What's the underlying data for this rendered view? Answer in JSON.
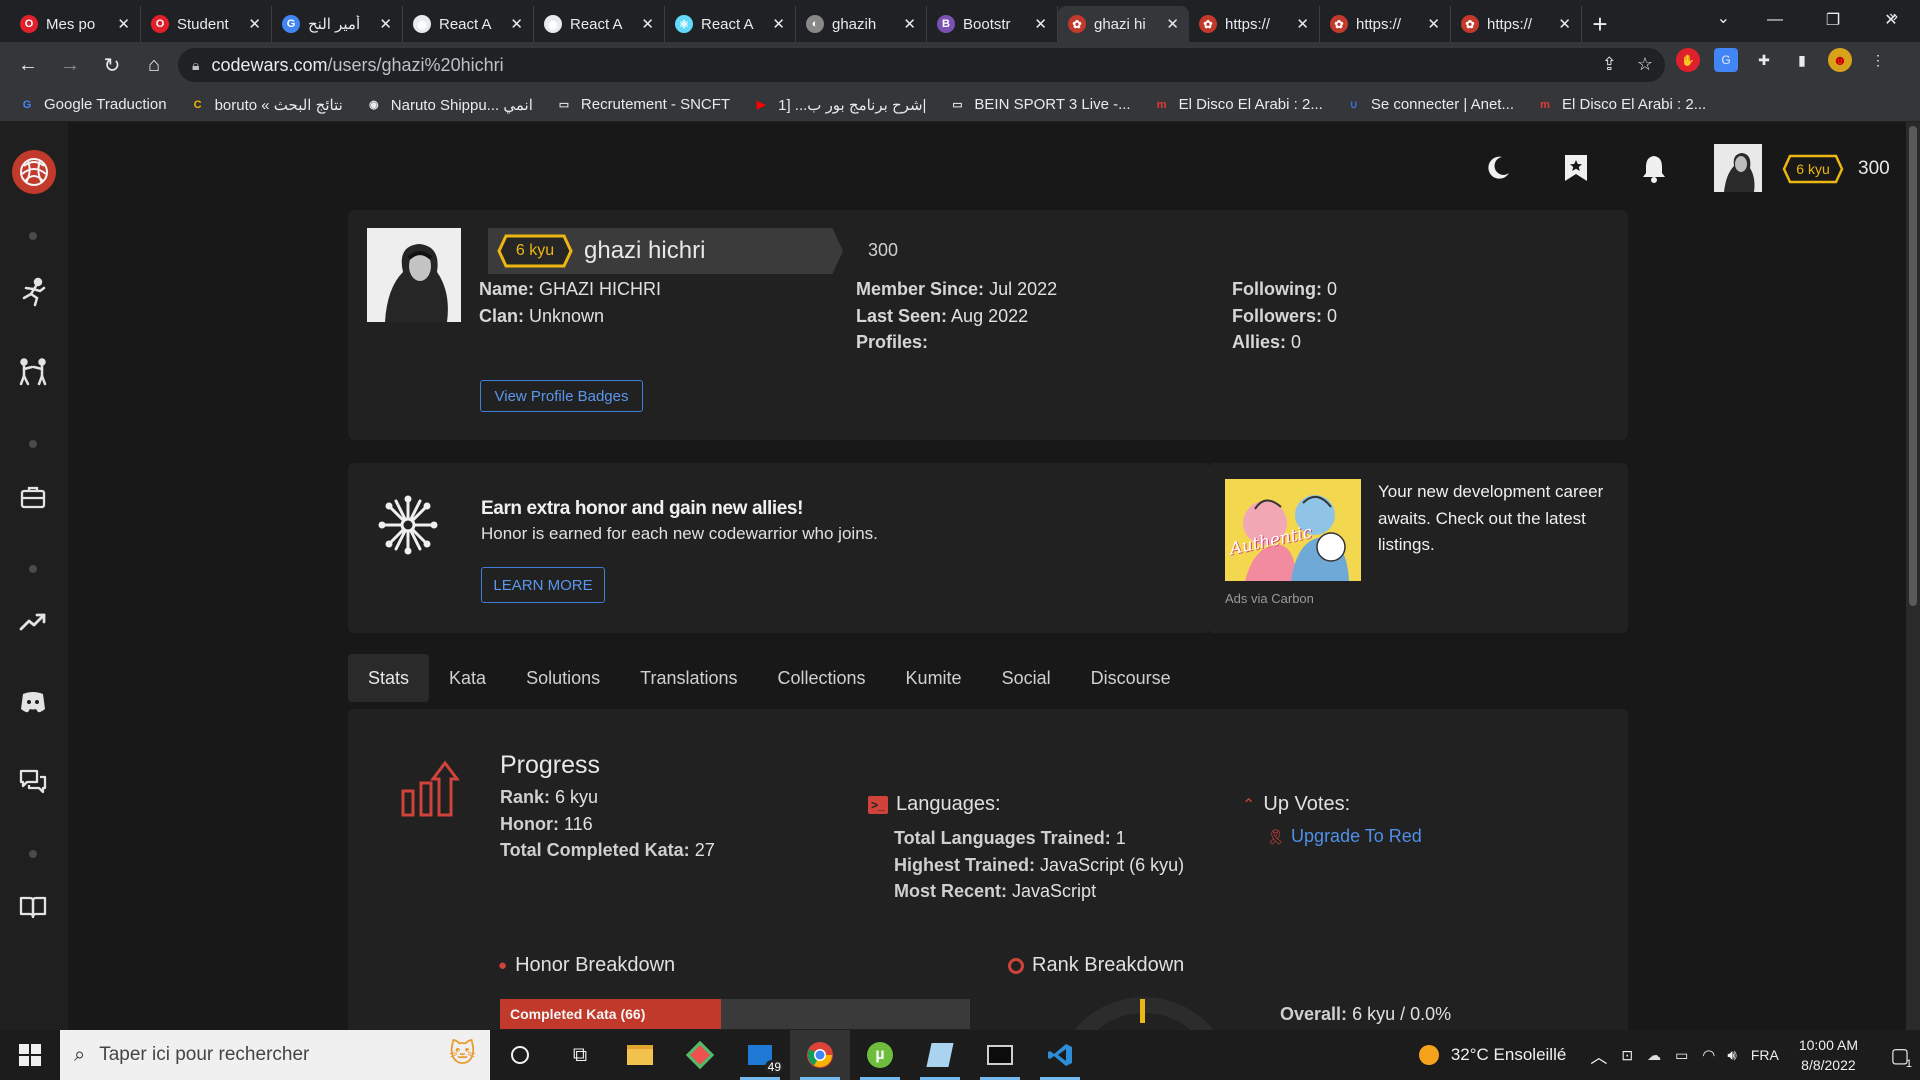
{
  "browser": {
    "tabs": [
      {
        "title": "Mes po",
        "fav": "O",
        "fav_color": "#e0202a"
      },
      {
        "title": "Student",
        "fav": "O",
        "fav_color": "#e0202a"
      },
      {
        "title": "أمير النح",
        "fav": "G",
        "fav_color": "#4285f4"
      },
      {
        "title": "React A",
        "fav": "◉",
        "fav_color": "#e8eaed"
      },
      {
        "title": "React A",
        "fav": "◉",
        "fav_color": "#e8eaed"
      },
      {
        "title": "React A",
        "fav": "⚛",
        "fav_color": "#61dafb"
      },
      {
        "title": "ghazih",
        "fav": "◐",
        "fav_color": "#888888"
      },
      {
        "title": "Bootstr",
        "fav": "B",
        "fav_color": "#7952b3"
      },
      {
        "title": "ghazi hi",
        "fav": "✿",
        "fav_color": "#c23a2b"
      },
      {
        "title": "https://",
        "fav": "✿",
        "fav_color": "#c23a2b"
      },
      {
        "title": "https://",
        "fav": "✿",
        "fav_color": "#c23a2b"
      },
      {
        "title": "https://",
        "fav": "✿",
        "fav_color": "#c23a2b"
      }
    ],
    "active_tab_index": 8,
    "url_domain": "codewars.com",
    "url_path": "/users/ghazi%20hichri",
    "bookmarks": [
      {
        "label": "Google Traduction",
        "icon": "G",
        "color": "#4285f4"
      },
      {
        "label": "boruto « نتائج البحث",
        "icon": "C",
        "color": "#f4b400"
      },
      {
        "label": "Naruto Shippu... انمي",
        "icon": "◉",
        "color": "#e8eaed"
      },
      {
        "label": "Recrutement - SNCFT",
        "icon": "▭",
        "color": "#dddddd"
      },
      {
        "label": "شرح برنامج بور ب... [1|",
        "icon": "▶",
        "color": "#ff0000"
      },
      {
        "label": "BEIN SPORT 3 Live -...",
        "icon": "▭",
        "color": "#dddddd"
      },
      {
        "label": "El Disco El Arabi : 2...",
        "icon": "m",
        "color": "#e53935"
      },
      {
        "label": "Se connecter | Anet...",
        "icon": "∪",
        "color": "#3b6fd6"
      },
      {
        "label": "El Disco El Arabi : 2...",
        "icon": "m",
        "color": "#e53935"
      }
    ]
  },
  "header": {
    "rank": "6 kyu",
    "honor": "300"
  },
  "profile": {
    "rank": "6 kyu",
    "username": "ghazi hichri",
    "honor": "300",
    "name_label": "Name:",
    "name_value": "GHAZI HICHRI",
    "clan_label": "Clan:",
    "clan_value": "Unknown",
    "member_since_label": "Member Since:",
    "member_since_value": "Jul 2022",
    "last_seen_label": "Last Seen:",
    "last_seen_value": "Aug 2022",
    "profiles_label": "Profiles:",
    "following_label": "Following:",
    "following_value": "0",
    "followers_label": "Followers:",
    "followers_value": "0",
    "allies_label": "Allies:",
    "allies_value": "0",
    "badges_button": "View Profile Badges"
  },
  "allies_promo": {
    "title": "Earn extra honor and gain new allies!",
    "text": "Honor is earned for each new codewarrior who joins.",
    "button": "LEARN MORE"
  },
  "ad": {
    "text": "Your new development career awaits. Check out the latest listings.",
    "via": "Ads via Carbon",
    "image_word": "Authentic"
  },
  "profile_tabs": [
    "Stats",
    "Kata",
    "Solutions",
    "Translations",
    "Collections",
    "Kumite",
    "Social",
    "Discourse"
  ],
  "active_profile_tab": 0,
  "stats": {
    "progress_title": "Progress",
    "rank_label": "Rank:",
    "rank_value": "6 kyu",
    "honor_label": "Honor:",
    "honor_value": "116",
    "completed_label": "Total Completed Kata:",
    "completed_value": "27",
    "languages_title": "Languages:",
    "total_lang_label": "Total Languages Trained:",
    "total_lang_value": "1",
    "highest_label": "Highest Trained:",
    "highest_value": "JavaScript (6 kyu)",
    "recent_label": "Most Recent:",
    "recent_value": "JavaScript",
    "upvotes_title": "Up Votes:",
    "upgrade_link": "Upgrade To Red",
    "honor_breakdown_title": "Honor Breakdown",
    "completed_kata_bar": "Completed Kata (66)",
    "completed_kata_fraction": 0.47,
    "rank_breakdown_title": "Rank Breakdown",
    "overall_label": "Overall:",
    "overall_value": "6 kyu / 0.0%"
  },
  "taskbar": {
    "search_placeholder": "Taper ici pour rechercher",
    "mail_badge": "49",
    "weather": "32°C  Ensoleillé",
    "lang": "FRA",
    "time": "10:00 AM",
    "date": "8/8/2022",
    "notif_count": "1"
  },
  "colors": {
    "brand": "#c23a2b",
    "rank_yellow": "#ecb613",
    "link_blue": "#4f8fe6"
  }
}
